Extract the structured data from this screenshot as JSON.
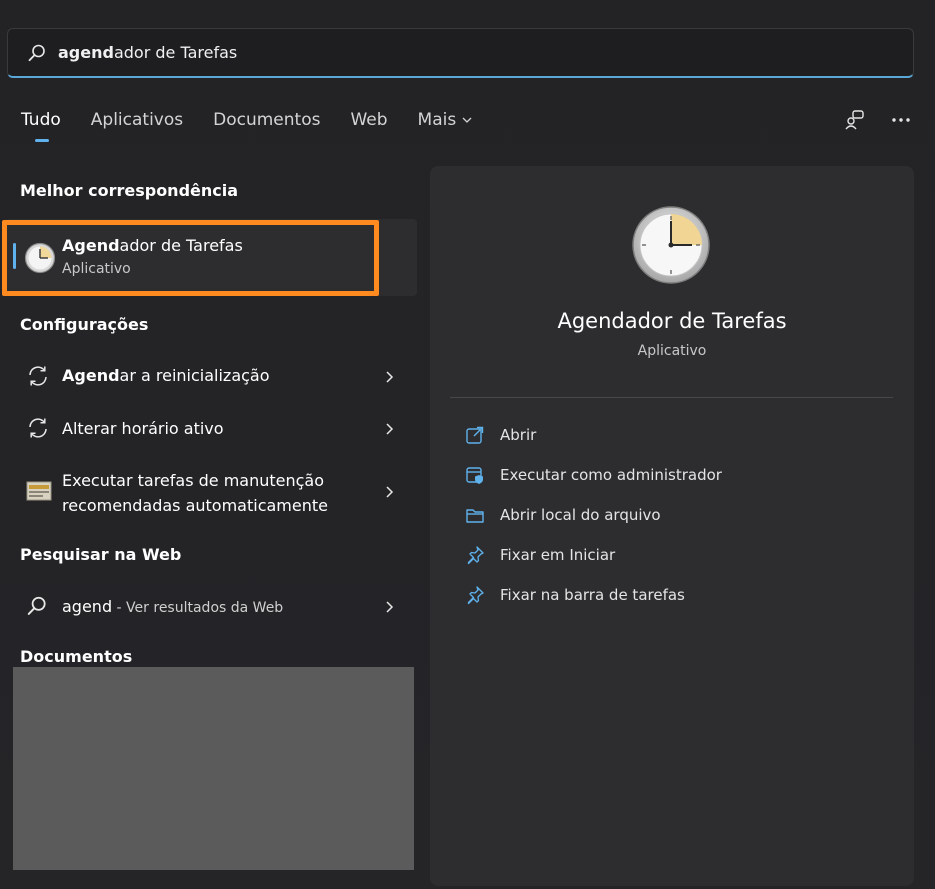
{
  "search": {
    "query_bold": "agend",
    "query_rest": "ador de Tarefas"
  },
  "tabs": [
    {
      "label": "Tudo",
      "active": true
    },
    {
      "label": "Aplicativos"
    },
    {
      "label": "Documentos"
    },
    {
      "label": "Web"
    },
    {
      "label": "Mais"
    }
  ],
  "sections": {
    "best_match": "Melhor correspondência",
    "settings": "Configurações",
    "web": "Pesquisar na Web",
    "documents": "Documentos"
  },
  "best_match": {
    "title_bold": "Agend",
    "title_rest": "ador de Tarefas",
    "subtitle": "Aplicativo"
  },
  "settings_items": [
    {
      "bold": "Agend",
      "rest": "ar a reinicialização"
    },
    {
      "label": "Alterar horário ativo"
    },
    {
      "line1": "Executar tarefas de manutenção",
      "line2": "recomendadas automaticamente"
    }
  ],
  "web_result": {
    "query": "agend",
    "suffix": " - Ver resultados da Web"
  },
  "detail": {
    "title": "Agendador de Tarefas",
    "subtitle": "Aplicativo",
    "actions": [
      {
        "label": "Abrir",
        "icon": "open-external-icon"
      },
      {
        "label": "Executar como administrador",
        "icon": "admin-shield-icon"
      },
      {
        "label": "Abrir local do arquivo",
        "icon": "folder-icon"
      },
      {
        "label": "Fixar em Iniciar",
        "icon": "pin-icon"
      },
      {
        "label": "Fixar na barra de tarefas",
        "icon": "pin-icon"
      }
    ]
  },
  "colors": {
    "accent": "#5fb2ec",
    "highlight": "#ff8a1f"
  }
}
